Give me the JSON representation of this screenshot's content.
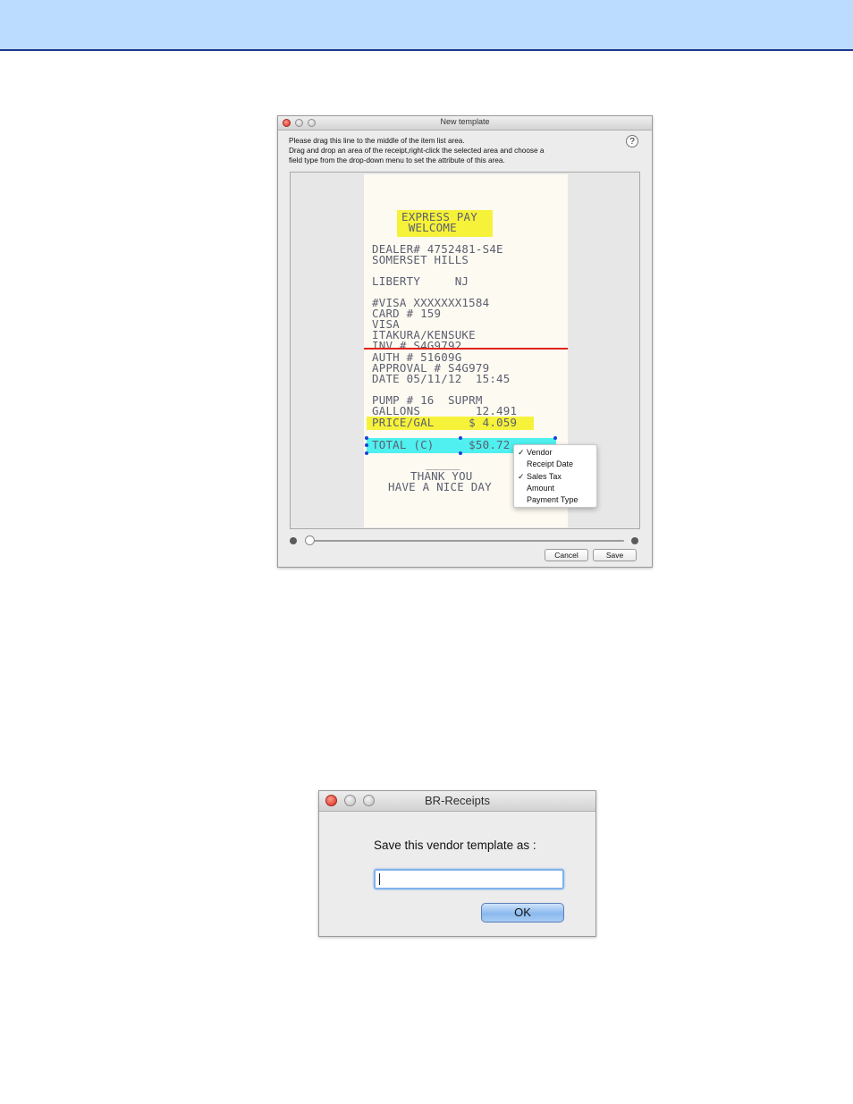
{
  "new_template_window": {
    "title": "New template",
    "instructions": [
      "Please drag this line to the middle of  the item list area.",
      "Drag and drop an area of the receipt,right-click the selected area and choose a",
      "field type from the drop-down menu to set the attribute of this area."
    ],
    "help_label": "?",
    "receipt_lines": [
      "EXPRESS PAY",
      " WELCOME",
      "DEALER# 4752481-S4E",
      "SOMERSET HILLS",
      "LIBERTY     NJ",
      "#VISA XXXXXXX1584",
      "CARD # 159",
      "VISA",
      "ITAKURA/KENSUKE",
      "INV # S4G9792",
      "AUTH # 51609G",
      "APPROVAL # S4G979",
      "DATE 05/11/12  15:45",
      "PUMP # 16  SUPRM",
      "GALLONS        12.491",
      "PRICE/GAL     $ 4.059",
      "TOTAL (C)     $50.72",
      "_____",
      "THANK YOU",
      "HAVE A NICE DAY"
    ],
    "context_menu": [
      {
        "label": "Vendor",
        "check": "✓"
      },
      {
        "label": "Receipt Date",
        "check": ""
      },
      {
        "label": "Sales Tax",
        "check": "✓"
      },
      {
        "label": "Amount",
        "check": ""
      },
      {
        "label": "Payment Type",
        "check": ""
      }
    ],
    "zoom_level": 0.0,
    "cancel_label": "Cancel",
    "save_label": "Save"
  },
  "save_dialog": {
    "title": "BR-Receipts",
    "prompt": "Save this vendor template as :",
    "input_value": "",
    "ok_label": "OK"
  }
}
